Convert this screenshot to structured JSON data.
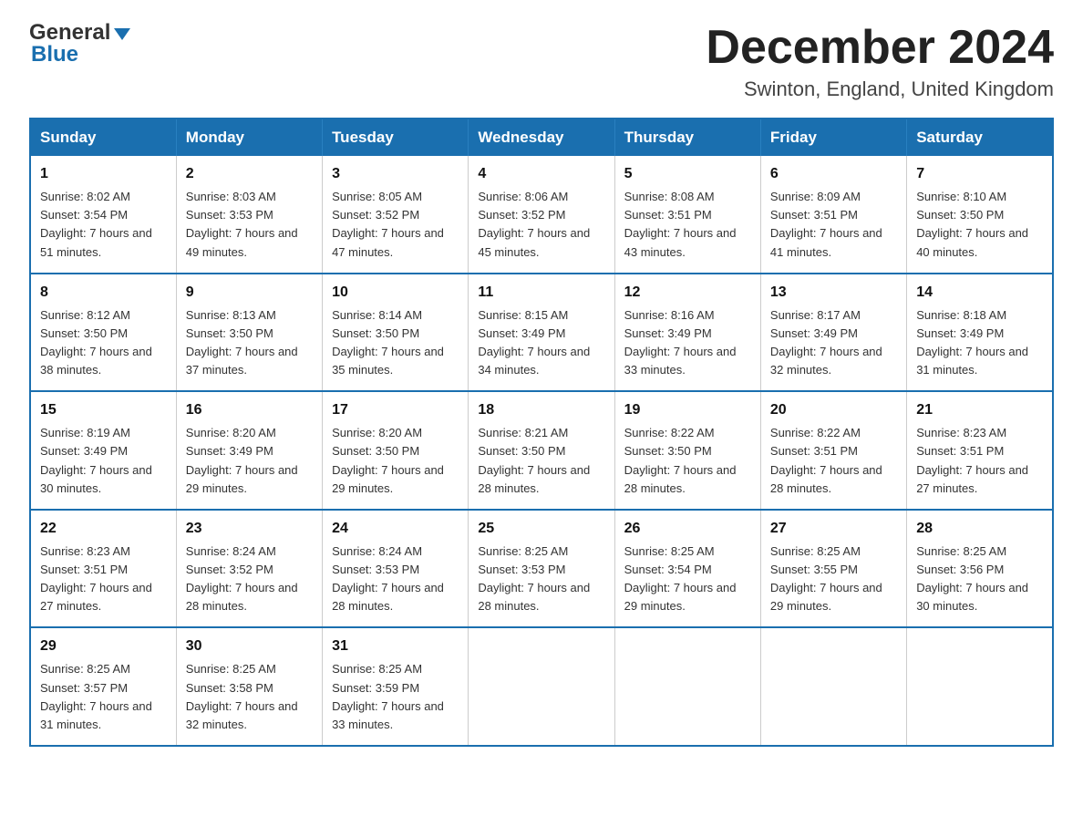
{
  "header": {
    "logo_general": "General",
    "logo_blue": "Blue",
    "month_title": "December 2024",
    "location": "Swinton, England, United Kingdom"
  },
  "days_of_week": [
    "Sunday",
    "Monday",
    "Tuesday",
    "Wednesday",
    "Thursday",
    "Friday",
    "Saturday"
  ],
  "weeks": [
    [
      {
        "day": "1",
        "sunrise": "8:02 AM",
        "sunset": "3:54 PM",
        "daylight": "7 hours and 51 minutes."
      },
      {
        "day": "2",
        "sunrise": "8:03 AM",
        "sunset": "3:53 PM",
        "daylight": "7 hours and 49 minutes."
      },
      {
        "day": "3",
        "sunrise": "8:05 AM",
        "sunset": "3:52 PM",
        "daylight": "7 hours and 47 minutes."
      },
      {
        "day": "4",
        "sunrise": "8:06 AM",
        "sunset": "3:52 PM",
        "daylight": "7 hours and 45 minutes."
      },
      {
        "day": "5",
        "sunrise": "8:08 AM",
        "sunset": "3:51 PM",
        "daylight": "7 hours and 43 minutes."
      },
      {
        "day": "6",
        "sunrise": "8:09 AM",
        "sunset": "3:51 PM",
        "daylight": "7 hours and 41 minutes."
      },
      {
        "day": "7",
        "sunrise": "8:10 AM",
        "sunset": "3:50 PM",
        "daylight": "7 hours and 40 minutes."
      }
    ],
    [
      {
        "day": "8",
        "sunrise": "8:12 AM",
        "sunset": "3:50 PM",
        "daylight": "7 hours and 38 minutes."
      },
      {
        "day": "9",
        "sunrise": "8:13 AM",
        "sunset": "3:50 PM",
        "daylight": "7 hours and 37 minutes."
      },
      {
        "day": "10",
        "sunrise": "8:14 AM",
        "sunset": "3:50 PM",
        "daylight": "7 hours and 35 minutes."
      },
      {
        "day": "11",
        "sunrise": "8:15 AM",
        "sunset": "3:49 PM",
        "daylight": "7 hours and 34 minutes."
      },
      {
        "day": "12",
        "sunrise": "8:16 AM",
        "sunset": "3:49 PM",
        "daylight": "7 hours and 33 minutes."
      },
      {
        "day": "13",
        "sunrise": "8:17 AM",
        "sunset": "3:49 PM",
        "daylight": "7 hours and 32 minutes."
      },
      {
        "day": "14",
        "sunrise": "8:18 AM",
        "sunset": "3:49 PM",
        "daylight": "7 hours and 31 minutes."
      }
    ],
    [
      {
        "day": "15",
        "sunrise": "8:19 AM",
        "sunset": "3:49 PM",
        "daylight": "7 hours and 30 minutes."
      },
      {
        "day": "16",
        "sunrise": "8:20 AM",
        "sunset": "3:49 PM",
        "daylight": "7 hours and 29 minutes."
      },
      {
        "day": "17",
        "sunrise": "8:20 AM",
        "sunset": "3:50 PM",
        "daylight": "7 hours and 29 minutes."
      },
      {
        "day": "18",
        "sunrise": "8:21 AM",
        "sunset": "3:50 PM",
        "daylight": "7 hours and 28 minutes."
      },
      {
        "day": "19",
        "sunrise": "8:22 AM",
        "sunset": "3:50 PM",
        "daylight": "7 hours and 28 minutes."
      },
      {
        "day": "20",
        "sunrise": "8:22 AM",
        "sunset": "3:51 PM",
        "daylight": "7 hours and 28 minutes."
      },
      {
        "day": "21",
        "sunrise": "8:23 AM",
        "sunset": "3:51 PM",
        "daylight": "7 hours and 27 minutes."
      }
    ],
    [
      {
        "day": "22",
        "sunrise": "8:23 AM",
        "sunset": "3:51 PM",
        "daylight": "7 hours and 27 minutes."
      },
      {
        "day": "23",
        "sunrise": "8:24 AM",
        "sunset": "3:52 PM",
        "daylight": "7 hours and 28 minutes."
      },
      {
        "day": "24",
        "sunrise": "8:24 AM",
        "sunset": "3:53 PM",
        "daylight": "7 hours and 28 minutes."
      },
      {
        "day": "25",
        "sunrise": "8:25 AM",
        "sunset": "3:53 PM",
        "daylight": "7 hours and 28 minutes."
      },
      {
        "day": "26",
        "sunrise": "8:25 AM",
        "sunset": "3:54 PM",
        "daylight": "7 hours and 29 minutes."
      },
      {
        "day": "27",
        "sunrise": "8:25 AM",
        "sunset": "3:55 PM",
        "daylight": "7 hours and 29 minutes."
      },
      {
        "day": "28",
        "sunrise": "8:25 AM",
        "sunset": "3:56 PM",
        "daylight": "7 hours and 30 minutes."
      }
    ],
    [
      {
        "day": "29",
        "sunrise": "8:25 AM",
        "sunset": "3:57 PM",
        "daylight": "7 hours and 31 minutes."
      },
      {
        "day": "30",
        "sunrise": "8:25 AM",
        "sunset": "3:58 PM",
        "daylight": "7 hours and 32 minutes."
      },
      {
        "day": "31",
        "sunrise": "8:25 AM",
        "sunset": "3:59 PM",
        "daylight": "7 hours and 33 minutes."
      },
      null,
      null,
      null,
      null
    ]
  ]
}
